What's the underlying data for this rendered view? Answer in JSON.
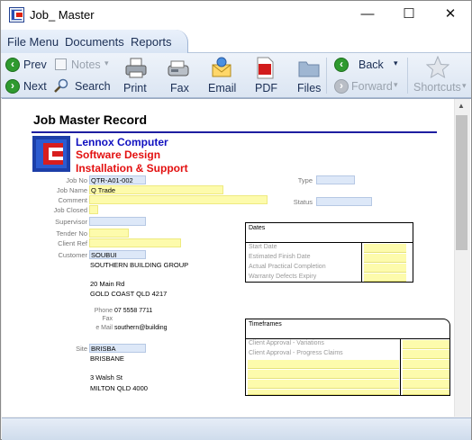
{
  "window": {
    "title": "Job_ Master",
    "minimize": "—",
    "maximize": "☐",
    "close": "✕"
  },
  "menu": {
    "items": [
      "File Menu",
      "Documents",
      "Reports"
    ]
  },
  "toolbar": {
    "prev": "Prev",
    "next": "Next",
    "notes": "Notes",
    "search": "Search",
    "print": "Print",
    "fax": "Fax",
    "email": "Email",
    "pdf": "PDF",
    "files": "Files",
    "back": "Back",
    "forward": "Forward",
    "shortcuts": "Shortcuts"
  },
  "record": {
    "heading": "Job Master Record",
    "company": {
      "line1": "Lennox Computer",
      "line2": "Software Design",
      "line3": "Installation & Support"
    },
    "labels": {
      "job_no": "Job No",
      "job_name": "Job Name",
      "comment": "Comment",
      "job_closed": "Job Closed",
      "supervisor": "Supervisor",
      "tender_no": "Tender No",
      "client_ref": "Client Ref",
      "customer": "Customer",
      "type": "Type",
      "status": "Status",
      "phone": "Phone",
      "fax": "Fax",
      "email": "e Mail",
      "site": "Site"
    },
    "values": {
      "job_no": "QTR-A01-002",
      "job_name": "Q Trade",
      "customer_code": "SOUBUI",
      "customer_name": "SOUTHERN BUILDING GROUP",
      "address1": "20 Main Rd",
      "address2": "GOLD COAST QLD 4217",
      "phone": "07 5558 7711",
      "email": "southern@building",
      "site_code": "BRISBA",
      "site_name": "BRISBANE",
      "site_address1": "3 Walsh St",
      "site_address2": "MILTON QLD 4000"
    },
    "dates": {
      "title": "Dates",
      "rows": [
        "Start Date",
        "Estimated Finish Date",
        "Actual Practical Completion",
        "Warranty Defects Expiry"
      ]
    },
    "timeframes": {
      "title": "Timeframes",
      "rows": [
        "Client Approval - Variations",
        "Client Approval - Progress Claims"
      ]
    }
  }
}
